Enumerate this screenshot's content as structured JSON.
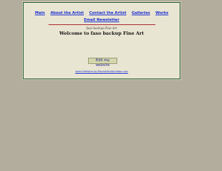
{
  "nav": {
    "items": [
      {
        "label": "Main"
      },
      {
        "label": "About the Artist"
      },
      {
        "label": "Contact the Artist"
      },
      {
        "label": "Galleries"
      },
      {
        "label": "Works"
      }
    ],
    "newsletter": "Email Newsletter"
  },
  "header": {
    "subtitle": "faso backup Fine Art",
    "title": "Welcome to faso backup Fine Art"
  },
  "edit_button": {
    "label": "Edit my website"
  },
  "footer": {
    "link": "Artist Websites by FineArtStudioOnline.com"
  },
  "colors": {
    "page_bg": "#b3ad9d",
    "panel_bg": "#e9e5d3",
    "panel_border": "#1d5a2a",
    "link": "#1a2ecf",
    "rule": "#a8242b",
    "button_bg": "#d4d7ab"
  }
}
